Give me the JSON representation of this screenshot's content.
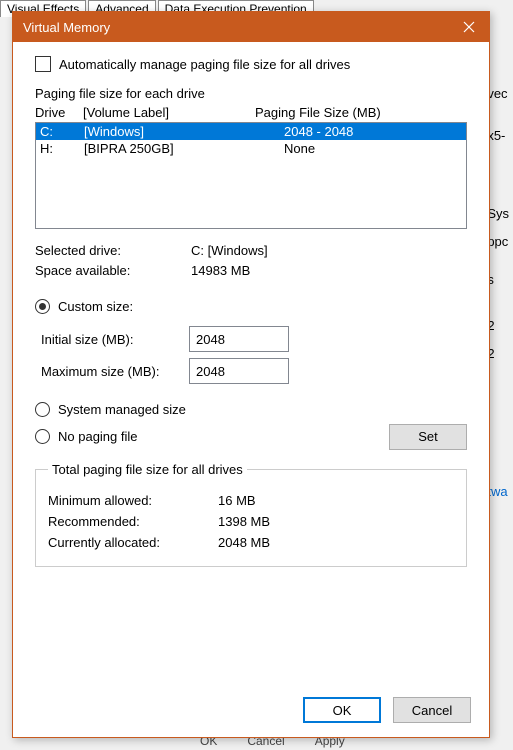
{
  "bg": {
    "tabs": [
      "Visual Effects",
      "Advanced",
      "Data Execution Prevention"
    ],
    "right_fragments": [
      "vec",
      "x5-",
      "Sys",
      "ppc",
      "s",
      "2",
      "2"
    ],
    "link": "twa",
    "bottom_buttons": [
      "OK",
      "Cancel",
      "Apply"
    ]
  },
  "dialog": {
    "title": "Virtual Memory",
    "auto_manage": "Automatically manage paging file size for all drives",
    "group_label": "Paging file size for each drive",
    "headers": {
      "drive": "Drive",
      "volume": "[Volume Label]",
      "size": "Paging File Size (MB)"
    },
    "drives": [
      {
        "letter": "C:",
        "label": "[Windows]",
        "size": "2048 - 2048",
        "selected": true
      },
      {
        "letter": "H:",
        "label": "[BIPRA 250GB]",
        "size": "None",
        "selected": false
      }
    ],
    "selected_drive_label": "Selected drive:",
    "selected_drive_value": "C:  [Windows]",
    "space_label": "Space available:",
    "space_value": "14983 MB",
    "radio_custom": "Custom size:",
    "initial_label": "Initial size (MB):",
    "initial_value": "2048",
    "max_label": "Maximum size (MB):",
    "max_value": "2048",
    "radio_system": "System managed size",
    "radio_none": "No paging file",
    "set_btn": "Set",
    "totals_legend": "Total paging file size for all drives",
    "min_label": "Minimum allowed:",
    "min_value": "16 MB",
    "rec_label": "Recommended:",
    "rec_value": "1398 MB",
    "cur_label": "Currently allocated:",
    "cur_value": "2048 MB",
    "ok": "OK",
    "cancel": "Cancel"
  }
}
